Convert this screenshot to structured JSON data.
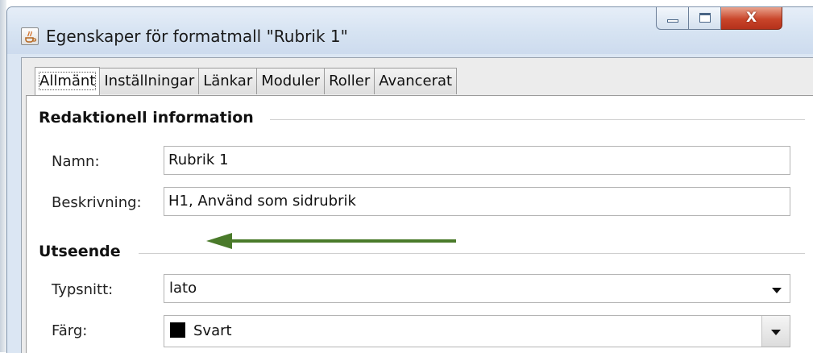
{
  "window": {
    "title": "Egenskaper för formatmall \"Rubrik 1\"",
    "app_icon": "java-coffee-cup-icon",
    "buttons": {
      "minimize_icon": "minimize-icon",
      "maximize_icon": "maximize-icon",
      "close_glyph": "X"
    }
  },
  "tabs": [
    {
      "label": "Allmänt",
      "active": true
    },
    {
      "label": "Inställningar",
      "active": false
    },
    {
      "label": "Länkar",
      "active": false
    },
    {
      "label": "Moduler",
      "active": false
    },
    {
      "label": "Roller",
      "active": false
    },
    {
      "label": "Avancerat",
      "active": false
    }
  ],
  "sections": {
    "editorial": {
      "title": "Redaktionell information",
      "name_label": "Namn:",
      "name_value": "Rubrik 1",
      "description_label": "Beskrivning:",
      "description_value": "H1, Använd som sidrubrik"
    },
    "appearance": {
      "title": "Utseende",
      "font_label": "Typsnitt:",
      "font_value": "lato",
      "color_label": "Färg:",
      "color_value": "Svart",
      "color_swatch": "#000000"
    }
  },
  "annotation": {
    "arrow_color": "#4a7a2a",
    "arrow_icon": "left-arrow-annotation-icon"
  }
}
